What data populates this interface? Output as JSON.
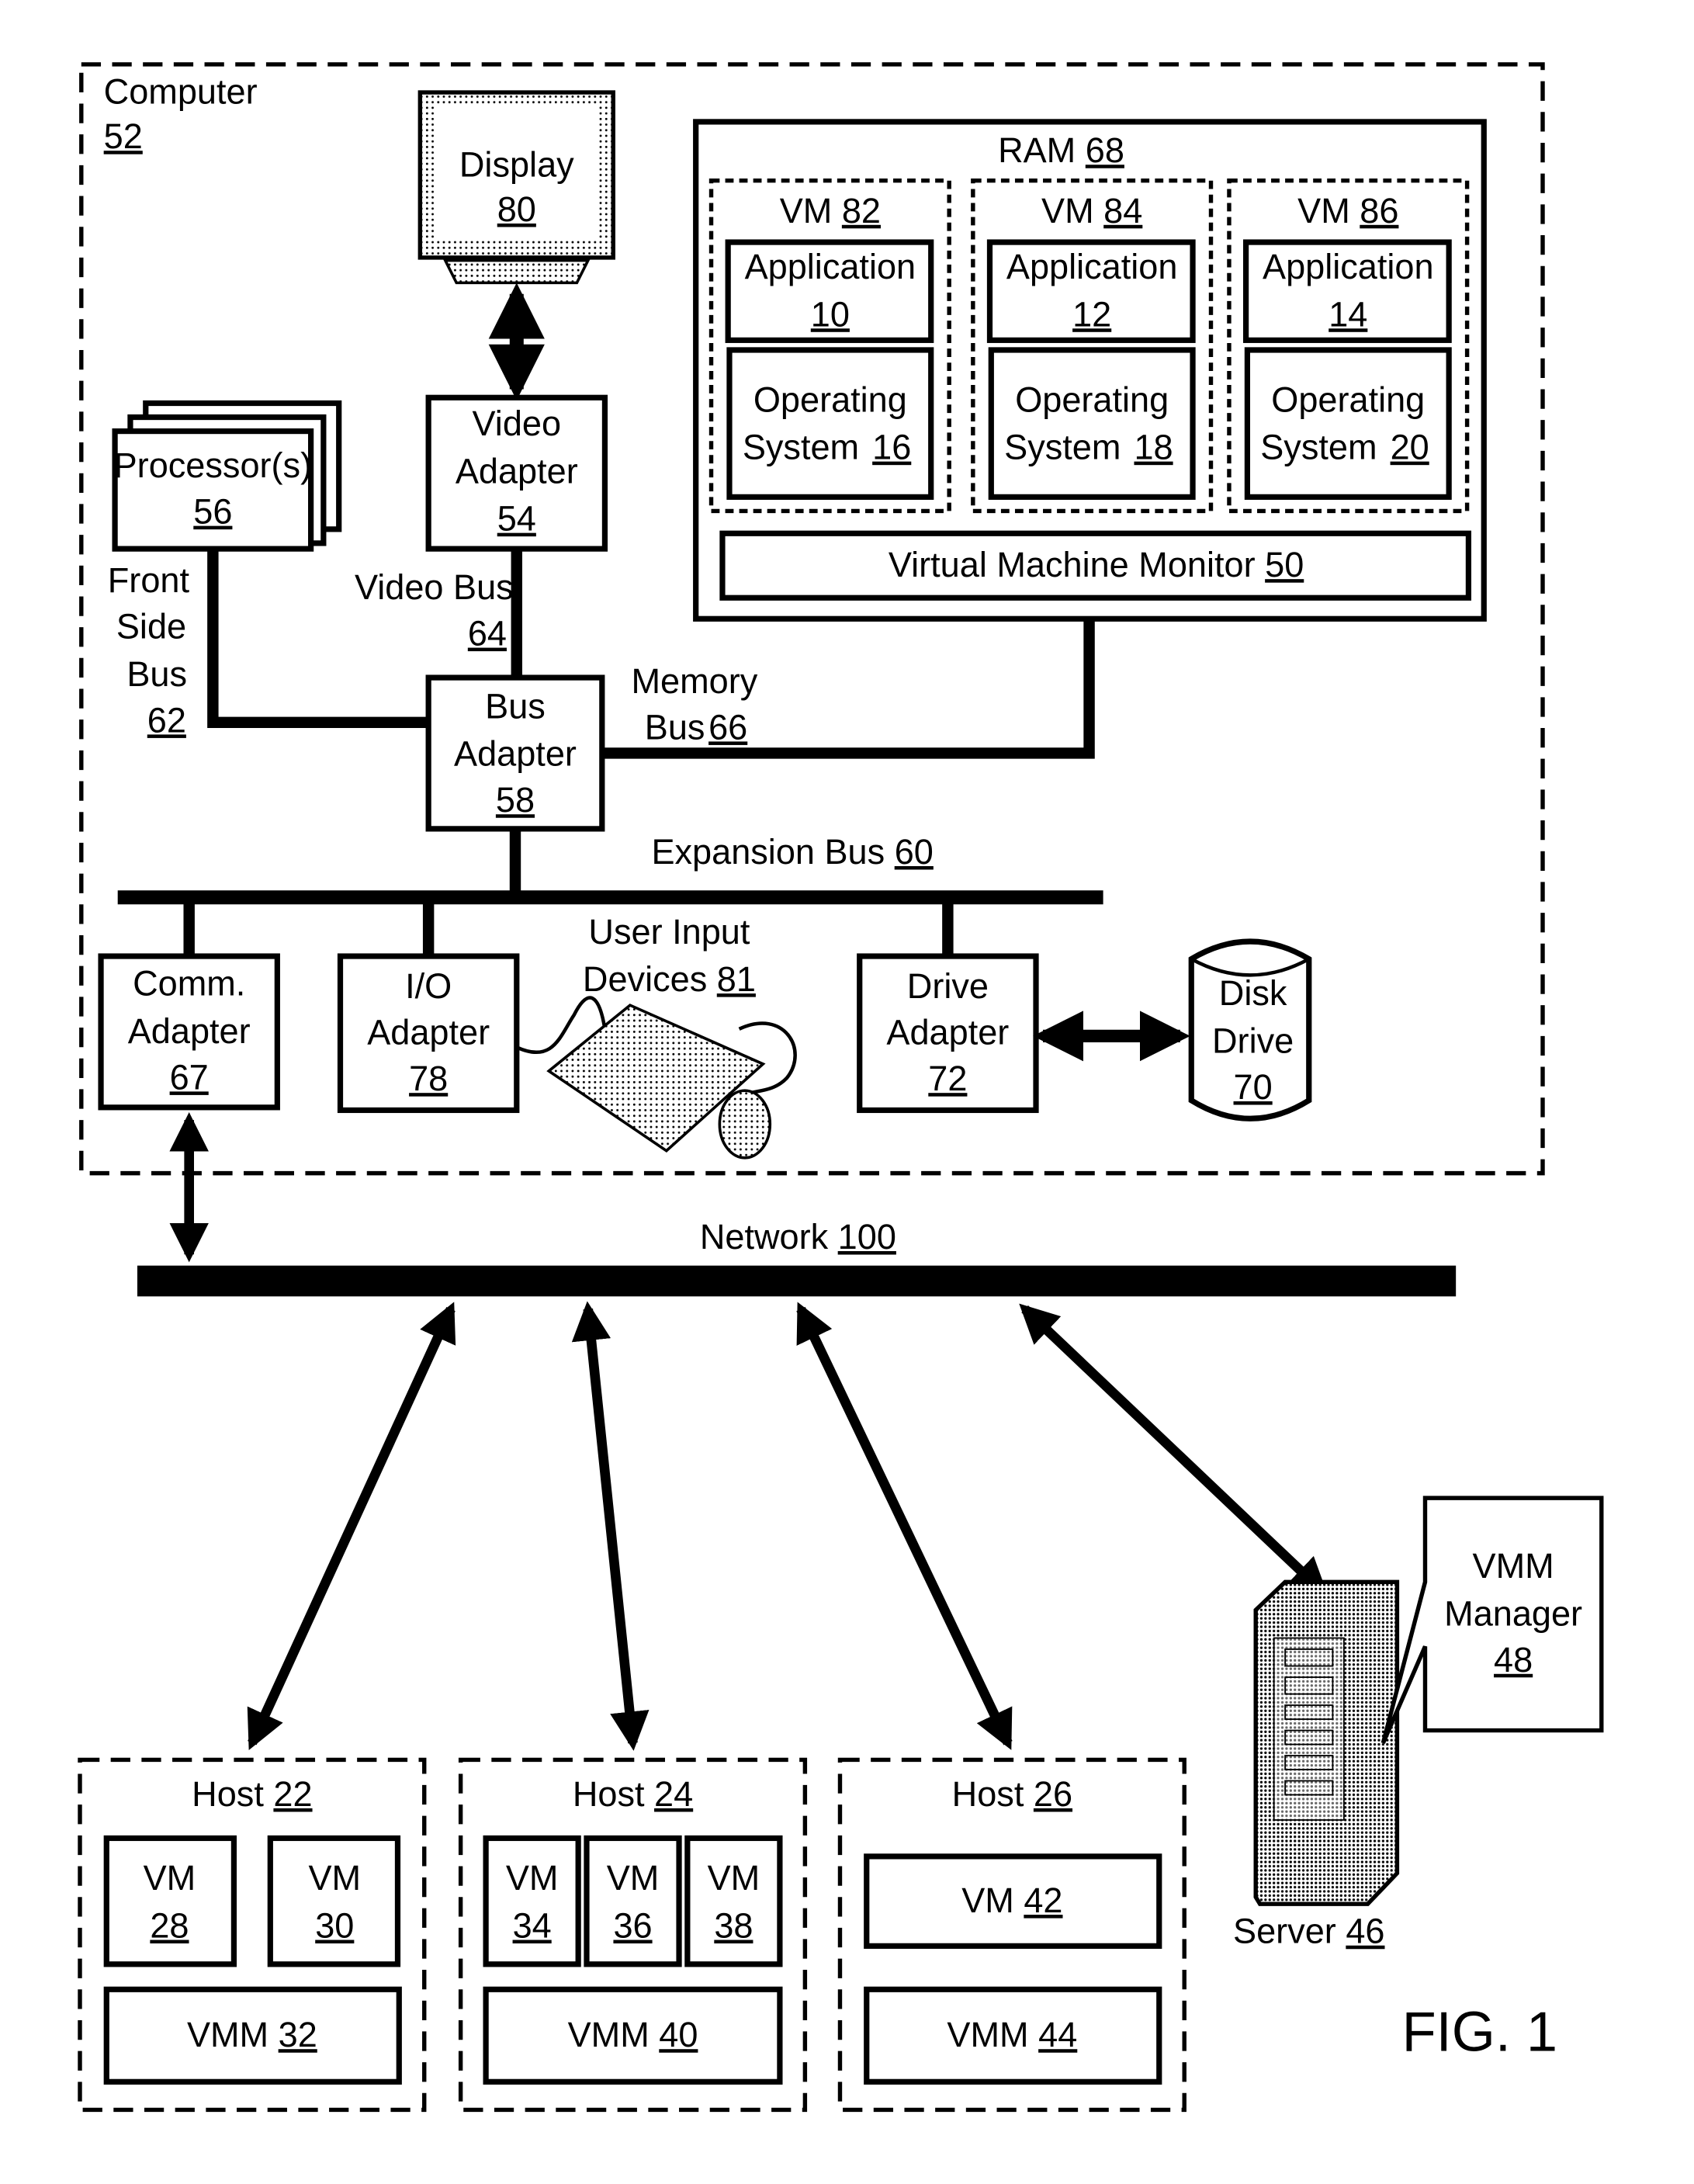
{
  "computer": {
    "label": "Computer",
    "ref": "52"
  },
  "display": {
    "label": "Display",
    "ref": "80"
  },
  "video_adapter": {
    "line1": "Video",
    "line2": "Adapter",
    "ref": "54"
  },
  "processors": {
    "label": "Processor(s)",
    "ref": "56"
  },
  "front_side_bus": {
    "line1": "Front",
    "line2": "Side",
    "line3": "Bus",
    "ref": "62"
  },
  "video_bus": {
    "label": "Video Bus",
    "ref": "64"
  },
  "bus_adapter": {
    "line1": "Bus",
    "line2": "Adapter",
    "ref": "58"
  },
  "memory_bus": {
    "line1": "Memory",
    "line2": "Bus",
    "ref": "66"
  },
  "ram": {
    "label": "RAM",
    "ref": "68"
  },
  "vms": [
    {
      "label": "VM",
      "ref": "82",
      "app_label": "Application",
      "app_ref": "10",
      "os_line1": "Operating",
      "os_line2": "System",
      "os_ref": "16"
    },
    {
      "label": "VM",
      "ref": "84",
      "app_label": "Application",
      "app_ref": "12",
      "os_line1": "Operating",
      "os_line2": "System",
      "os_ref": "18"
    },
    {
      "label": "VM",
      "ref": "86",
      "app_label": "Application",
      "app_ref": "14",
      "os_line1": "Operating",
      "os_line2": "System",
      "os_ref": "20"
    }
  ],
  "vmm": {
    "label": "Virtual Machine Monitor",
    "ref": "50"
  },
  "expansion_bus": {
    "label": "Expansion Bus",
    "ref": "60"
  },
  "comm_adapter": {
    "line1": "Comm.",
    "line2": "Adapter",
    "ref": "67"
  },
  "io_adapter": {
    "line1": "I/O",
    "line2": "Adapter",
    "ref": "78"
  },
  "user_input": {
    "line1": "User Input",
    "line2": "Devices",
    "ref": "81"
  },
  "drive_adapter": {
    "line1": "Drive",
    "line2": "Adapter",
    "ref": "72"
  },
  "disk_drive": {
    "line1": "Disk",
    "line2": "Drive",
    "ref": "70"
  },
  "network": {
    "label": "Network",
    "ref": "100"
  },
  "hosts": [
    {
      "label": "Host",
      "ref": "22",
      "vms": [
        {
          "label": "VM",
          "ref": "28"
        },
        {
          "label": "VM",
          "ref": "30"
        }
      ],
      "vmm": {
        "label": "VMM",
        "ref": "32"
      }
    },
    {
      "label": "Host",
      "ref": "24",
      "vms": [
        {
          "label": "VM",
          "ref": "34"
        },
        {
          "label": "VM",
          "ref": "36"
        },
        {
          "label": "VM",
          "ref": "38"
        }
      ],
      "vmm": {
        "label": "VMM",
        "ref": "40"
      }
    },
    {
      "label": "Host",
      "ref": "26",
      "vms": [
        {
          "label": "VM",
          "ref": "42"
        }
      ],
      "vmm": {
        "label": "VMM",
        "ref": "44"
      }
    }
  ],
  "server": {
    "label": "Server",
    "ref": "46"
  },
  "vmm_manager": {
    "line1": "VMM",
    "line2": "Manager",
    "ref": "48"
  },
  "figure_label": "FIG. 1"
}
